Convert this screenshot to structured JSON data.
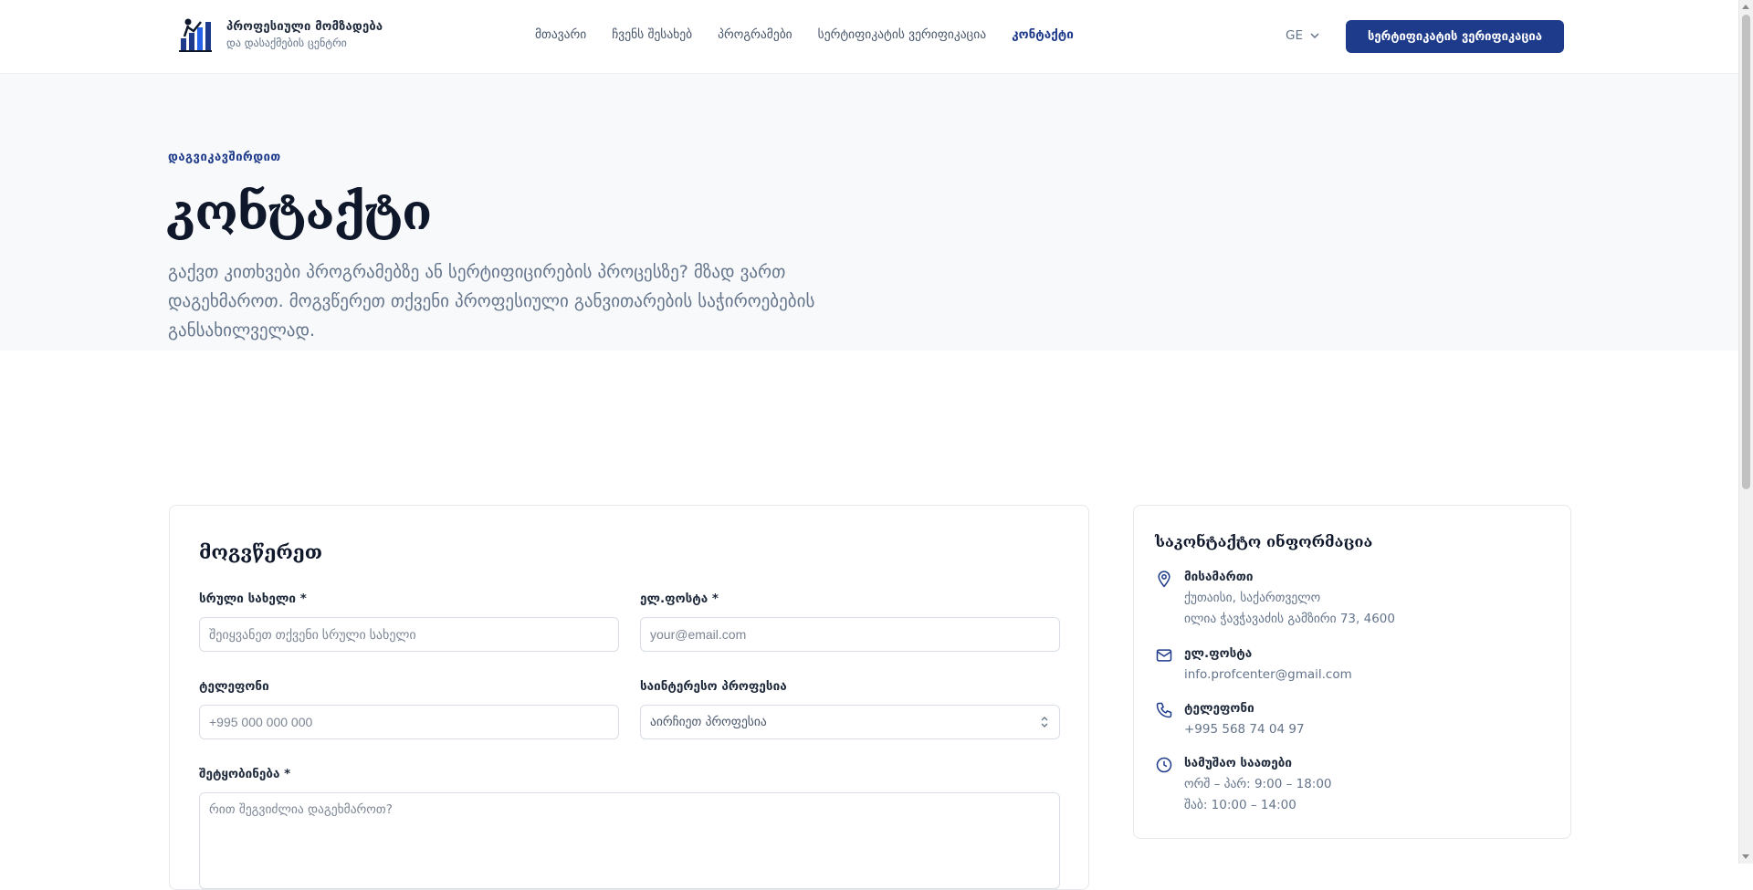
{
  "header": {
    "brand_title": "პროფესიული მომზადება",
    "brand_sub": "და დასაქმების ცენტრი",
    "nav": [
      {
        "label": "მთავარი",
        "active": false
      },
      {
        "label": "ჩვენს შესახებ",
        "active": false
      },
      {
        "label": "პროგრამები",
        "active": false
      },
      {
        "label": "სერტიფიკატის ვერიფიკაცია",
        "active": false
      },
      {
        "label": "კონტაქტი",
        "active": true
      }
    ],
    "lang": "GE",
    "cta_label": "სერტიფიკატის ვერიფიკაცია"
  },
  "hero": {
    "eyebrow": "დაგვიკავშირდით",
    "title": "კონტაქტი",
    "description": "გაქვთ კითხვები პროგრამებზე ან სერტიფიცირების პროცესზე? მზად ვართ დაგეხმაროთ. მოგვწერეთ თქვენი პროფესიული განვითარების საჭიროებების განსახილველად."
  },
  "form": {
    "title": "მოგვწერეთ",
    "full_name": {
      "label": "სრული სახელი *",
      "placeholder": "შეიყვანეთ თქვენი სრული სახელი",
      "value": ""
    },
    "email": {
      "label": "ელ.ფოსტა *",
      "placeholder": "your@email.com",
      "value": ""
    },
    "phone": {
      "label": "ტელეფონი",
      "placeholder": "+995 000 000 000",
      "value": ""
    },
    "profession": {
      "label": "საინტერესო პროფესია",
      "selected": "აირჩიეთ პროფესია"
    },
    "message": {
      "label": "შეტყობინება *",
      "placeholder": "რით შეგვიძლია დაგეხმაროთ?",
      "value": ""
    }
  },
  "contact_info": {
    "title": "საკონტაქტო ინფორმაცია",
    "address": {
      "label": "მისამართი",
      "line1": "ქუთაისი, საქართველო",
      "line2": "ილია ჭავჭავაძის გამზირი 73, 4600",
      "icon": "map-pin-icon"
    },
    "email": {
      "label": "ელ.ფოსტა",
      "value": "info.profcenter@gmail.com",
      "icon": "mail-icon"
    },
    "phone": {
      "label": "ტელეფონი",
      "value": "+995 568 74 04 97",
      "icon": "phone-icon"
    },
    "hours": {
      "label": "სამუშაო საათები",
      "line1": "ორშ – პარ: 9:00 – 18:00",
      "line2": "შაბ: 10:00 – 14:00",
      "icon": "clock-icon"
    }
  },
  "colors": {
    "primary": "#1e3a8a",
    "text": "#0f172a",
    "muted": "#64748b",
    "hero_bg": "#f8f9fb"
  }
}
